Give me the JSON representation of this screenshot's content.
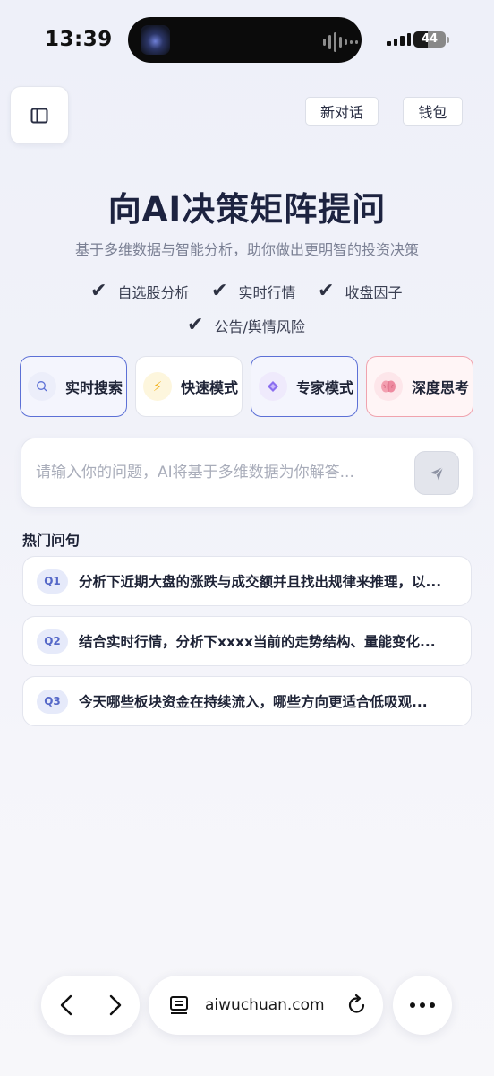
{
  "status_bar": {
    "time": "13:39",
    "battery": "44"
  },
  "header": {
    "new_chat_label": "新对话",
    "wallet_label": "钱包"
  },
  "hero": {
    "title": "向AI决策矩阵提问",
    "subtitle": "基于多维数据与智能分析，助你做出更明智的投资决策",
    "features": [
      "自选股分析",
      "实时行情",
      "收盘因子",
      "公告/舆情风险"
    ]
  },
  "modes": [
    {
      "label": "实时搜索",
      "icon": "search-icon",
      "color": "#5c70d6"
    },
    {
      "label": "快速模式",
      "icon": "lightning-icon",
      "color": "#f2b21c"
    },
    {
      "label": "专家模式",
      "icon": "diamond-icon",
      "color": "#7a5ae0"
    },
    {
      "label": "深度思考",
      "icon": "brain-icon",
      "color": "#f08a9a"
    }
  ],
  "ask": {
    "placeholder": "请输入你的问题，AI将基于多维数据为你解答...",
    "value": ""
  },
  "hot": {
    "title": "热门问句",
    "questions": [
      {
        "badge": "Q1",
        "text": "分析下近期大盘的涨跌与成交额并且找出规律来推理，以..."
      },
      {
        "badge": "Q2",
        "text": "结合实时行情，分析下xxxx当前的走势结构、量能变化..."
      },
      {
        "badge": "Q3",
        "text": "今天哪些板块资金在持续流入，哪些方向更适合低吸观..."
      }
    ]
  },
  "browser": {
    "url": "aiwuchuan.com"
  },
  "colors": {
    "accent": "#5c70d6",
    "title": "#1d2340",
    "pink_border": "#f0a3ae"
  }
}
